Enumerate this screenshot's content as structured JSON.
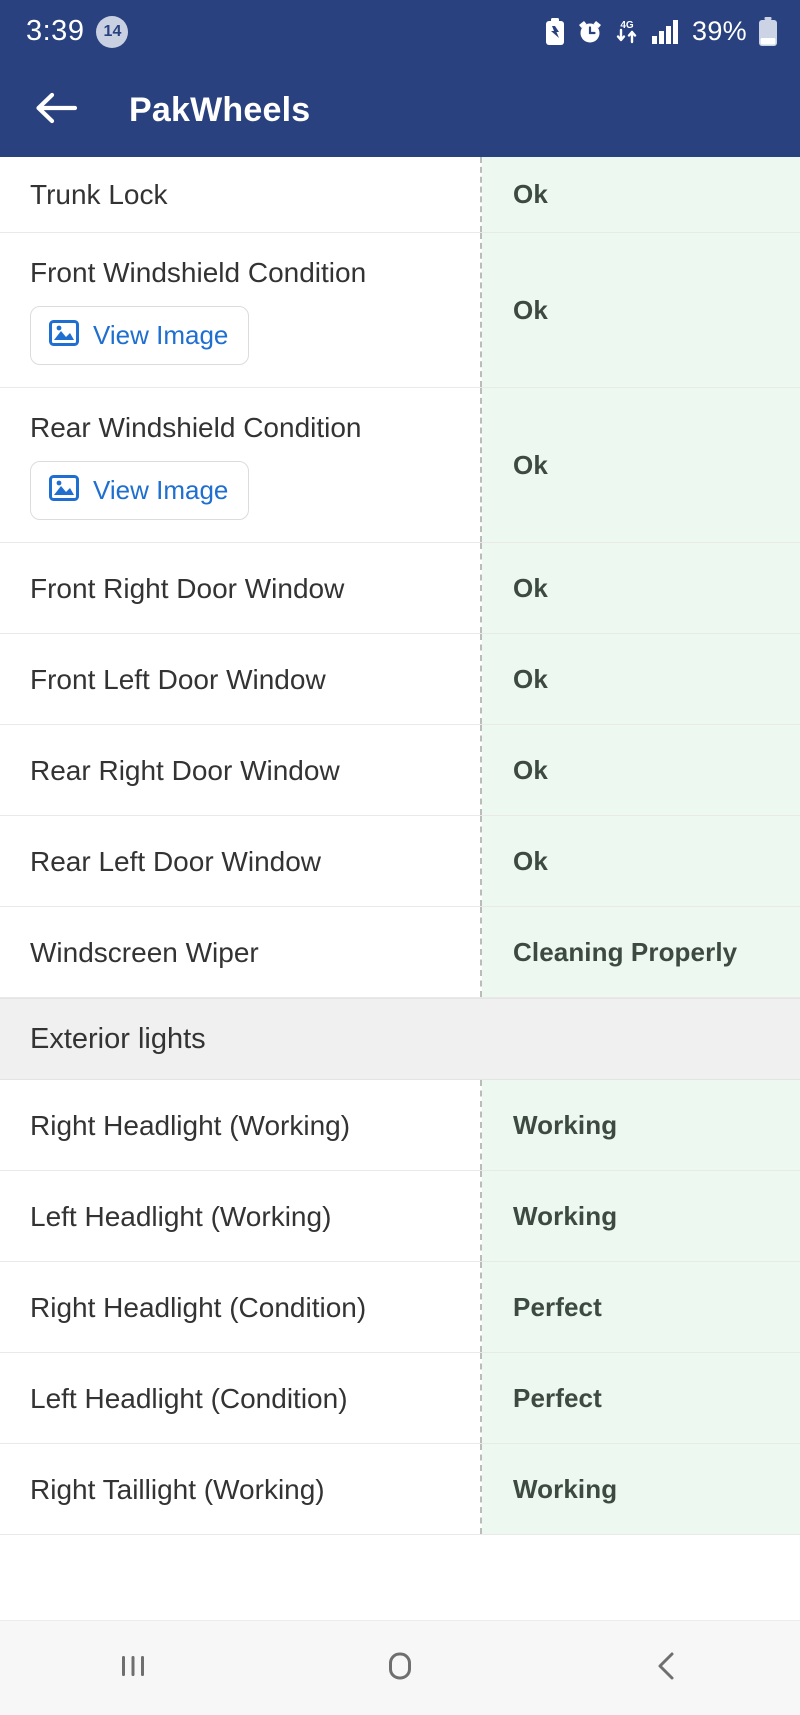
{
  "status_bar": {
    "time": "3:39",
    "notification_count": "14",
    "battery_percent": "39%",
    "icons": [
      "battery-saver-icon",
      "alarm-icon",
      "mobile-data-4g-icon",
      "signal-bars-icon",
      "battery-icon"
    ]
  },
  "app_bar": {
    "title": "PakWheels",
    "back_icon": "back-arrow-icon"
  },
  "inspection": {
    "view_image_label": "View Image",
    "rows": [
      {
        "label": "Trunk Lock",
        "value": "Ok",
        "has_image": false,
        "partial": true
      },
      {
        "label": "Front Windshield Condition",
        "value": "Ok",
        "has_image": true,
        "partial": false
      },
      {
        "label": "Rear Windshield Condition",
        "value": "Ok",
        "has_image": true,
        "partial": false
      },
      {
        "label": "Front Right Door Window",
        "value": "Ok",
        "has_image": false,
        "partial": false
      },
      {
        "label": "Front Left Door Window",
        "value": "Ok",
        "has_image": false,
        "partial": false
      },
      {
        "label": "Rear Right Door Window",
        "value": "Ok",
        "has_image": false,
        "partial": false
      },
      {
        "label": "Rear Left Door Window",
        "value": "Ok",
        "has_image": false,
        "partial": false
      },
      {
        "label": "Windscreen Wiper",
        "value": "Cleaning Properly",
        "has_image": false,
        "partial": false
      }
    ],
    "section": {
      "title": "Exterior lights"
    },
    "section_rows": [
      {
        "label": "Right Headlight (Working)",
        "value": "Working",
        "has_image": false,
        "partial": false
      },
      {
        "label": "Left Headlight (Working)",
        "value": "Working",
        "has_image": false,
        "partial": false
      },
      {
        "label": "Right Headlight (Condition)",
        "value": "Perfect",
        "has_image": false,
        "partial": false
      },
      {
        "label": "Left Headlight (Condition)",
        "value": "Perfect",
        "has_image": false,
        "partial": false
      },
      {
        "label": "Right Taillight (Working)",
        "value": "Working",
        "has_image": false,
        "partial": false
      }
    ]
  },
  "nav_bar": {
    "recents_icon": "recents-icon",
    "home_icon": "home-icon",
    "back_icon": "back-chevron-icon"
  },
  "colors": {
    "brand_navy": "#2a4180",
    "value_bg_green": "#edf9f0",
    "link_blue": "#1f6fd0",
    "section_bg": "#f0f0f0"
  }
}
